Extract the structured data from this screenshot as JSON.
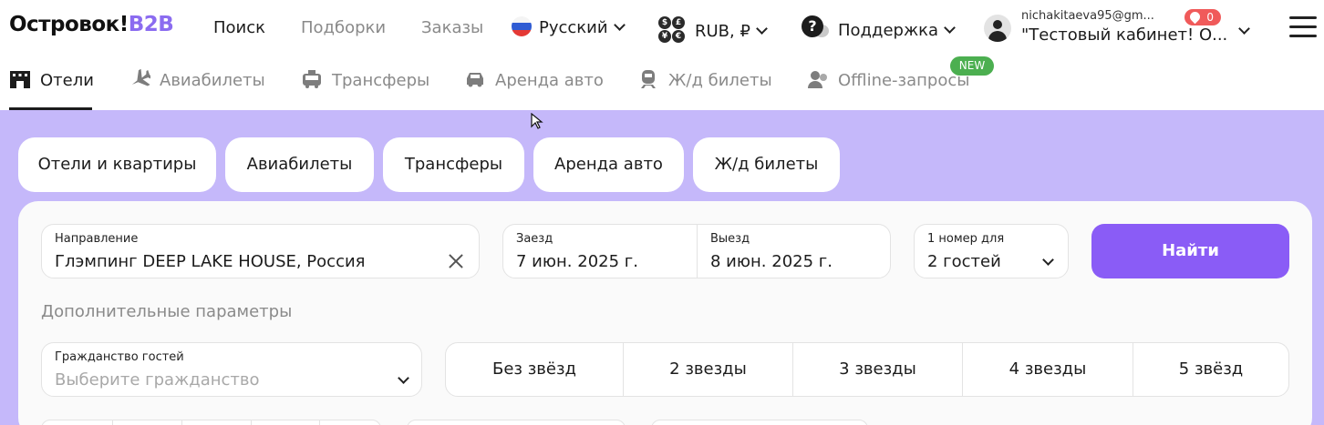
{
  "header": {
    "logo_text": "Островок!",
    "logo_suffix": "B2B",
    "nav": {
      "search": "Поиск",
      "collections": "Подборки",
      "orders": "Заказы"
    },
    "language": "Русский",
    "currency": "RUB, ₽",
    "support": "Поддержка",
    "user_email": "nichakitaeva95@gm...",
    "user_company": "\"Тестовый кабинет! О...",
    "notifications_count": "0"
  },
  "tabs": [
    {
      "label": "Отели",
      "icon": "hotel-icon",
      "active": true
    },
    {
      "label": "Авиабилеты",
      "icon": "plane-icon",
      "active": false
    },
    {
      "label": "Трансферы",
      "icon": "transfer-icon",
      "active": false
    },
    {
      "label": "Аренда авто",
      "icon": "car-icon",
      "active": false
    },
    {
      "label": "Ж/д билеты",
      "icon": "train-icon",
      "active": false
    },
    {
      "label": "Offline-запросы",
      "icon": "offline-requests-icon",
      "active": false
    }
  ],
  "new_badge": "NEW",
  "quick_pills": [
    "Отели и квартиры",
    "Авиабилеты",
    "Трансферы",
    "Аренда авто",
    "Ж/д билеты"
  ],
  "search_form": {
    "destination": {
      "label": "Направление",
      "value": "Глэмпинг DEEP LAKE HOUSE, Россия"
    },
    "checkin": {
      "label": "Заезд",
      "value": "7 июн. 2025 г."
    },
    "checkout": {
      "label": "Выезд",
      "value": "8 июн. 2025 г."
    },
    "guests": {
      "label": "1 номер для",
      "value": "2 гостей"
    },
    "search_button": "Найти"
  },
  "extra_params_label": "Дополнительные параметры",
  "citizenship": {
    "label": "Гражданство гостей",
    "placeholder": "Выберите гражданство"
  },
  "star_options": [
    "Без звёзд",
    "2 звезды",
    "3 звезды",
    "4 звезды",
    "5 звёзд"
  ],
  "colors": {
    "brand": "#8b6cf0",
    "accent": "#8a5cf6",
    "background": "#c5b8fa",
    "new_badge": "#4caf50",
    "notification": "#f05a5a"
  }
}
